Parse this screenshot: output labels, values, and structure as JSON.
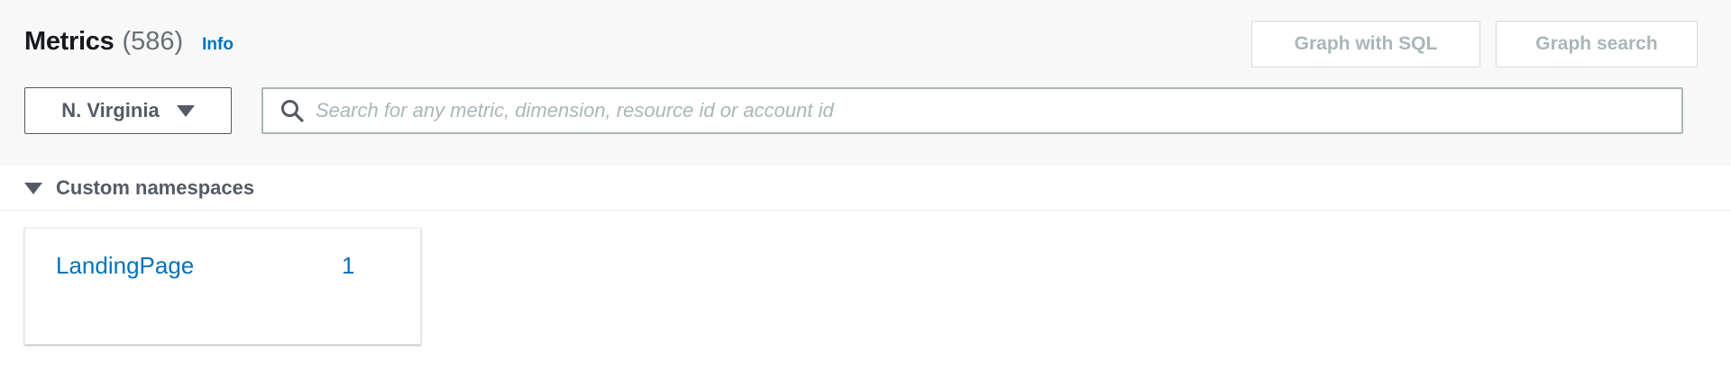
{
  "header": {
    "title": "Metrics",
    "count": "(586)",
    "info_label": "Info",
    "graph_sql_label": "Graph with SQL",
    "graph_search_label": "Graph search"
  },
  "filters": {
    "region_label": "N. Virginia",
    "search_placeholder": "Search for any metric, dimension, resource id or account id",
    "search_value": ""
  },
  "section": {
    "label": "Custom namespaces",
    "namespaces": [
      {
        "name": "LandingPage",
        "count": "1"
      }
    ]
  },
  "colors": {
    "link": "#0073bb",
    "text_dark": "#16191f",
    "text_muted": "#687078",
    "disabled": "#aab7b8",
    "header_bg": "#f8f8f8"
  },
  "icons": {
    "search": "search-icon",
    "region_dropdown": "caret-down-icon",
    "section_toggle": "triangle-down-icon"
  }
}
